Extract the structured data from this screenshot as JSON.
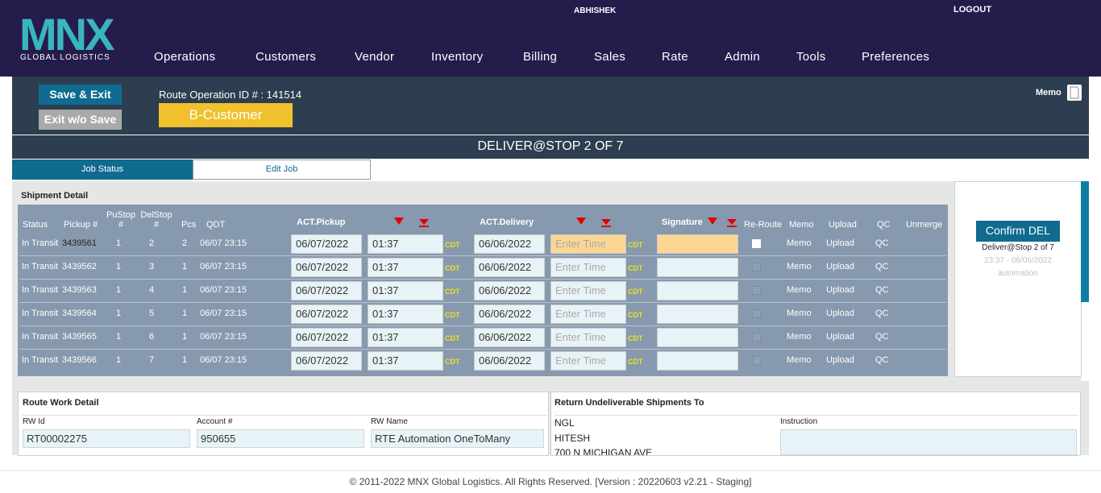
{
  "header": {
    "logo_text": "MNX",
    "logo_sub": "GLOBAL LOGISTICS",
    "user": "ABHISHEK",
    "logout": "LOGOUT",
    "nav": [
      "Operations",
      "Customers",
      "Vendor",
      "Inventory",
      "Billing",
      "Sales",
      "Rate",
      "Admin",
      "Tools",
      "Preferences"
    ]
  },
  "ops": {
    "save_exit": "Save & Exit",
    "exit_no_save": "Exit w/o Save",
    "route_label": "Route Operation ID # : 141514",
    "customer": "B-Customer",
    "memo": "Memo",
    "deliver_title": "DELIVER@STOP 2 OF 7"
  },
  "tabs": {
    "job_status": "Job Status",
    "edit_job": "Edit Job"
  },
  "shipment": {
    "title": "Shipment Detail",
    "headers": {
      "status": "Status",
      "pickup": "Pickup #",
      "pustop": "PuStop #",
      "delstop": "DelStop #",
      "pcs": "Pcs",
      "qdt": "QDT",
      "act_pickup": "ACT.Pickup",
      "act_delivery": "ACT.Delivery",
      "signature": "Signature",
      "reroute": "Re-Route",
      "memo": "Memo",
      "upload": "Upload",
      "qc": "QC",
      "unmerge": "Unmerge"
    },
    "tz": "CDT",
    "rows": [
      {
        "status": "In Transit",
        "pickup": "3439561",
        "pustop": "1",
        "delstop": "2",
        "pcs": "2",
        "qdt": "06/07 23:15",
        "pu_date": "06/07/2022",
        "pu_time": "01:37",
        "del_date": "06/06/2022",
        "del_time": "Enter Time",
        "signature": "",
        "reroute": true,
        "memo": "Memo",
        "upload": "Upload",
        "qc": "QC"
      },
      {
        "status": "In Transit",
        "pickup": "3439562",
        "pustop": "1",
        "delstop": "3",
        "pcs": "1",
        "qdt": "06/07 23:15",
        "pu_date": "06/07/2022",
        "pu_time": "01:37",
        "del_date": "06/06/2022",
        "del_time": "Enter Time",
        "signature": "",
        "reroute": false,
        "memo": "Memo",
        "upload": "Upload",
        "qc": "QC"
      },
      {
        "status": "In Transit",
        "pickup": "3439563",
        "pustop": "1",
        "delstop": "4",
        "pcs": "1",
        "qdt": "06/07 23:15",
        "pu_date": "06/07/2022",
        "pu_time": "01:37",
        "del_date": "06/06/2022",
        "del_time": "Enter Time",
        "signature": "",
        "reroute": false,
        "memo": "Memo",
        "upload": "Upload",
        "qc": "QC"
      },
      {
        "status": "In Transit",
        "pickup": "3439564",
        "pustop": "1",
        "delstop": "5",
        "pcs": "1",
        "qdt": "06/07 23:15",
        "pu_date": "06/07/2022",
        "pu_time": "01:37",
        "del_date": "06/06/2022",
        "del_time": "Enter Time",
        "signature": "",
        "reroute": false,
        "memo": "Memo",
        "upload": "Upload",
        "qc": "QC"
      },
      {
        "status": "In Transit",
        "pickup": "3439565",
        "pustop": "1",
        "delstop": "6",
        "pcs": "1",
        "qdt": "06/07 23:15",
        "pu_date": "06/07/2022",
        "pu_time": "01:37",
        "del_date": "06/06/2022",
        "del_time": "Enter Time",
        "signature": "",
        "reroute": false,
        "memo": "Memo",
        "upload": "Upload",
        "qc": "QC"
      },
      {
        "status": "In Transit",
        "pickup": "3439566",
        "pustop": "1",
        "delstop": "7",
        "pcs": "1",
        "qdt": "06/07 23:15",
        "pu_date": "06/07/2022",
        "pu_time": "01:37",
        "del_date": "06/06/2022",
        "del_time": "Enter Time",
        "signature": "",
        "reroute": false,
        "memo": "Memo",
        "upload": "Upload",
        "qc": "QC"
      }
    ]
  },
  "confirm": {
    "button": "Confirm DEL",
    "stop": "Deliver@Stop 2 of 7",
    "time": "23:37 - 06/06/2022",
    "user": "automation"
  },
  "route_work": {
    "title": "Route Work Detail",
    "rw_id_label": "RW Id",
    "rw_id": "RT00002275",
    "account_label": "Account #",
    "account": "950655",
    "rw_name_label": "RW Name",
    "rw_name": "RTE Automation OneToMany"
  },
  "return": {
    "title": "Return Undeliverable Shipments To",
    "line1": "NGL",
    "line2": "HITESH",
    "line3": "700 N MICHIGAN AVE",
    "instruction_label": "Instruction"
  },
  "footer": "© 2011-2022 MNX Global Logistics. All Rights Reserved. [Version : 20220603 v2.21 - Staging]",
  "colors": {
    "nav_bg": "#261c4c",
    "ops_bg": "#2c3e4f",
    "accent": "#0f6b8f",
    "customer": "#f0c12c",
    "grid": "#8799ae"
  }
}
